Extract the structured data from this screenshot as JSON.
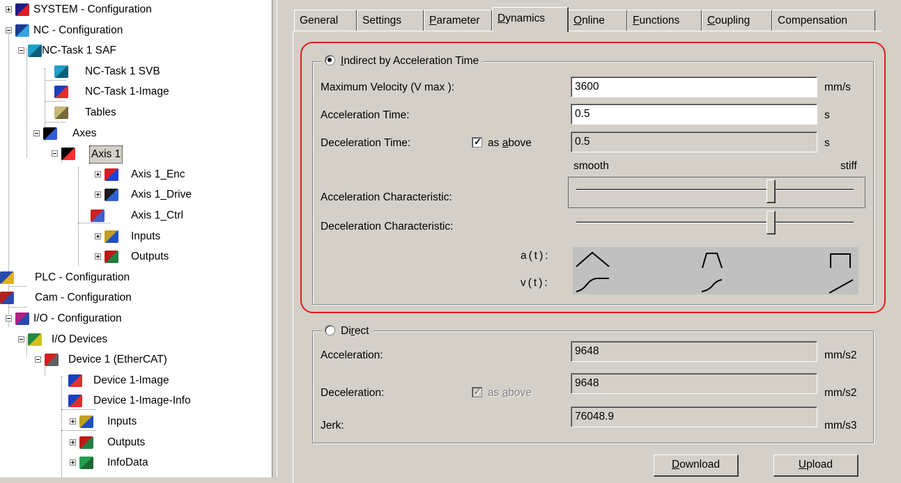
{
  "tree": {
    "items": [
      {
        "label": "SYSTEM - Configuration",
        "expander": "plus",
        "icon": "system-config-icon"
      },
      {
        "label": "NC - Configuration",
        "expander": "minus",
        "icon": "nc-config-icon"
      },
      {
        "label": "NC-Task 1 SAF",
        "expander": "minus",
        "icon": "task-icon"
      },
      {
        "label": "NC-Task 1 SVB",
        "icon": "task-icon"
      },
      {
        "label": "NC-Task 1-Image",
        "icon": "image-icon"
      },
      {
        "label": "Tables",
        "icon": "tables-icon"
      },
      {
        "label": "Axes",
        "expander": "minus",
        "icon": "axes-icon"
      },
      {
        "label": "Axis 1",
        "expander": "minus",
        "icon": "axis-icon",
        "selected": true
      },
      {
        "label": "Axis 1_Enc",
        "expander": "plus",
        "icon": "encoder-icon"
      },
      {
        "label": "Axis 1_Drive",
        "expander": "plus",
        "icon": "drive-icon"
      },
      {
        "label": "Axis 1_Ctrl",
        "icon": "controller-icon"
      },
      {
        "label": "Inputs",
        "expander": "plus",
        "icon": "inputs-icon"
      },
      {
        "label": "Outputs",
        "expander": "plus",
        "icon": "outputs-icon"
      },
      {
        "label": "PLC - Configuration",
        "icon": "plc-config-icon"
      },
      {
        "label": "Cam - Configuration",
        "icon": "cam-config-icon"
      },
      {
        "label": "I/O - Configuration",
        "expander": "minus",
        "icon": "io-config-icon"
      },
      {
        "label": "I/O Devices",
        "expander": "minus",
        "icon": "io-devices-icon"
      },
      {
        "label": "Device 1 (EtherCAT)",
        "expander": "minus",
        "icon": "ethercat-icon"
      },
      {
        "label": "Device 1-Image",
        "icon": "image-icon"
      },
      {
        "label": "Device 1-Image-Info",
        "icon": "image-icon"
      },
      {
        "label": "Inputs",
        "expander": "plus",
        "icon": "inputs-icon"
      },
      {
        "label": "Outputs",
        "expander": "plus",
        "icon": "outputs-icon"
      },
      {
        "label": "InfoData",
        "expander": "plus",
        "icon": "infodata-icon"
      }
    ]
  },
  "tabs": [
    {
      "pre": "General",
      "u": "",
      "post": ""
    },
    {
      "pre": "Settings",
      "u": "",
      "post": ""
    },
    {
      "pre": "",
      "u": "P",
      "post": "arameter"
    },
    {
      "pre": "",
      "u": "D",
      "post": "ynamics",
      "active": true
    },
    {
      "pre": "",
      "u": "O",
      "post": "nline"
    },
    {
      "pre": "",
      "u": "F",
      "post": "unctions"
    },
    {
      "pre": "",
      "u": "C",
      "post": "oupling"
    },
    {
      "pre": "Compensation",
      "u": "",
      "post": ""
    }
  ],
  "indirect": {
    "legend_pre": "",
    "legend_u": "I",
    "legend_post": "ndirect by Acceleration Time",
    "selected": true,
    "max_velocity_label": "Maximum Velocity (V max ):",
    "max_velocity_value": "3600",
    "max_velocity_unit": "mm/s",
    "acc_time_label": "Acceleration Time:",
    "acc_time_value": "0.5",
    "acc_time_unit": "s",
    "dec_time_label": "Deceleration Time:",
    "dec_as_above_pre": "as ",
    "dec_as_above_u": "a",
    "dec_as_above_post": "bove",
    "dec_as_above_checked": true,
    "dec_time_value": "0.5",
    "dec_time_unit": "s",
    "scale_left": "smooth",
    "scale_right": "stiff",
    "acc_char_label": "Acceleration Characteristic:",
    "acc_char_position": 0.7,
    "dec_char_label": "Deceleration Characteristic:",
    "dec_char_position": 0.7,
    "at_label": "a(t):",
    "vt_label": "v(t):"
  },
  "direct": {
    "legend_pre": "Di",
    "legend_u": "r",
    "legend_post": "ect",
    "selected": false,
    "acceleration_label": "Acceleration:",
    "acceleration_value": "9648",
    "acceleration_unit": "mm/s2",
    "deceleration_label": "Deceleration:",
    "dec_as_above_pre": "as ",
    "dec_as_above_u": "a",
    "dec_as_above_post": "bove",
    "deceleration_value": "9648",
    "deceleration_unit": "mm/s2",
    "jerk_label": "Jerk:",
    "jerk_value": "76048.9",
    "jerk_unit": "mm/s3"
  },
  "buttons": {
    "download_u": "D",
    "download_post": "ownload",
    "upload_u": "U",
    "upload_post": "pload"
  },
  "colors": {
    "highlight": "#e8191c",
    "dialog": "#d4d0c8"
  }
}
